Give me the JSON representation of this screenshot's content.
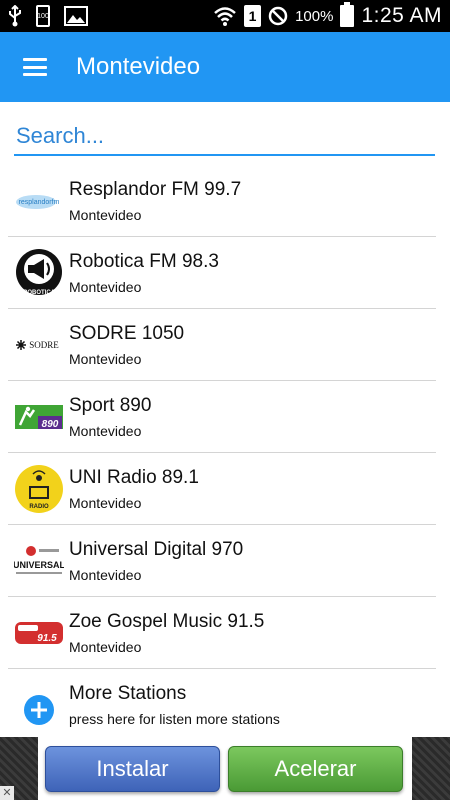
{
  "status_bar": {
    "battery_text": "100%",
    "time": "1:25 AM",
    "sim_label": "1",
    "notification_battery_label": "100"
  },
  "app_bar": {
    "title": "Montevideo"
  },
  "search": {
    "placeholder": "Search..."
  },
  "stations": [
    {
      "name": "Resplandor FM 99.7",
      "city": "Montevideo",
      "logo_text": "resplandorfm"
    },
    {
      "name": "Robotica FM 98.3",
      "city": "Montevideo",
      "logo_text": "ROBOTICA"
    },
    {
      "name": "SODRE 1050",
      "city": "Montevideo",
      "logo_text": "SODRE"
    },
    {
      "name": "Sport 890",
      "city": "Montevideo",
      "logo_text": "890"
    },
    {
      "name": "UNI Radio 89.1",
      "city": "Montevideo",
      "logo_text": "RADIO"
    },
    {
      "name": "Universal Digital 970",
      "city": "Montevideo",
      "logo_text": "UNIVERSAL"
    },
    {
      "name": "Zoe Gospel Music 91.5",
      "city": "Montevideo",
      "logo_text": "91.5"
    }
  ],
  "more_stations": {
    "title": "More Stations",
    "subtitle": "press here for listen more stations"
  },
  "ad": {
    "install_label": "Instalar",
    "speed_label": "Acelerar",
    "close_label": "✕"
  },
  "colors": {
    "primary": "#2196f3",
    "status_bar": "#000000",
    "divider": "#d4d4d4"
  }
}
